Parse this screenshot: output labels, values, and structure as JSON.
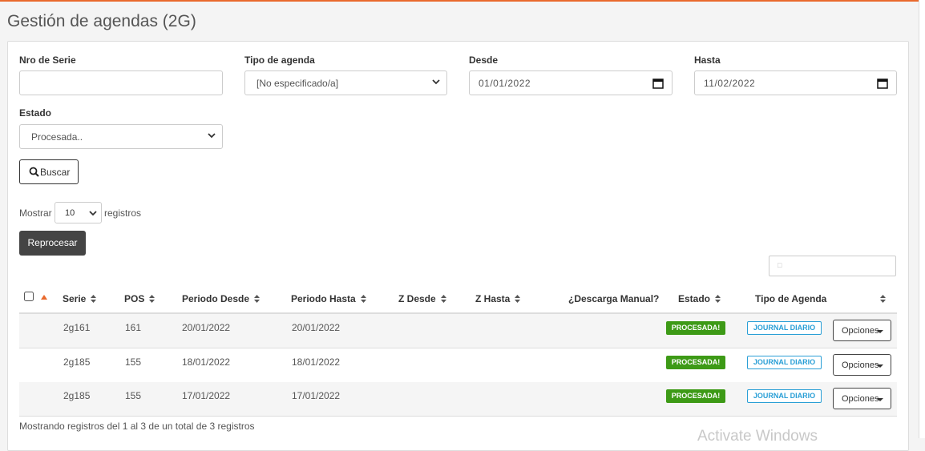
{
  "page": {
    "title": "Gestión de agendas (2G)"
  },
  "filters": {
    "nro_serie": {
      "label": "Nro de Serie",
      "value": ""
    },
    "tipo_agenda": {
      "label": "Tipo de agenda",
      "selected": "[No especificado/a]"
    },
    "desde": {
      "label": "Desde",
      "value": "01/01/2022"
    },
    "hasta": {
      "label": "Hasta",
      "value": "11/02/2022"
    },
    "estado": {
      "label": "Estado",
      "selected": "Procesada.."
    },
    "buscar_label": "Buscar"
  },
  "length_control": {
    "prefix": "Mostrar",
    "selected": "10",
    "suffix": "registros"
  },
  "reprocesar_label": "Reprocesar",
  "table": {
    "columns": [
      "Serie",
      "POS",
      "Periodo Desde",
      "Periodo Hasta",
      "Z Desde",
      "Z Hasta",
      "¿Descarga Manual?",
      "Estado",
      "Tipo de Agenda"
    ],
    "rows": [
      {
        "serie": "2g161",
        "pos": "161",
        "periodo_desde": "20/01/2022",
        "periodo_hasta": "20/01/2022",
        "estado": "PROCESADA!",
        "tipo": "JOURNAL DIARIO",
        "opciones": "Opciones"
      },
      {
        "serie": "2g185",
        "pos": "155",
        "periodo_desde": "18/01/2022",
        "periodo_hasta": "18/01/2022",
        "estado": "PROCESADA!",
        "tipo": "JOURNAL DIARIO",
        "opciones": "Opciones"
      },
      {
        "serie": "2g185",
        "pos": "155",
        "periodo_desde": "17/01/2022",
        "periodo_hasta": "17/01/2022",
        "estado": "PROCESADA!",
        "tipo": "JOURNAL DIARIO",
        "opciones": "Opciones"
      }
    ]
  },
  "info_text": "Mostrando registros del 1 al 3 de un total de 3 registros",
  "watermark": "Activate Windows",
  "colors": {
    "accent": "#e9692c",
    "estado_badge": "#3d9a16",
    "tipo_badge": "#2a9fd6",
    "reprocesar_bg": "#444444"
  }
}
